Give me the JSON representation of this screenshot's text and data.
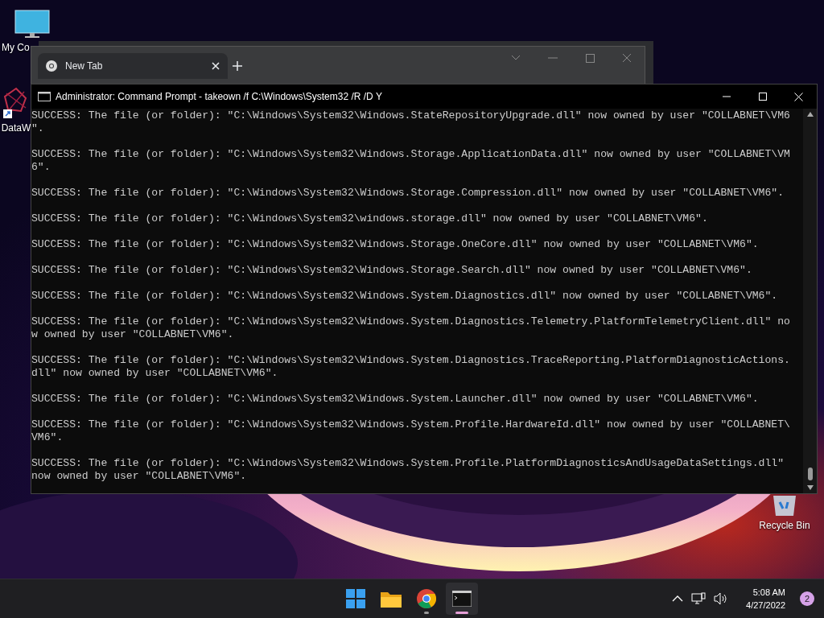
{
  "desktop_icons": [
    {
      "kind": "computer",
      "label": "My Co"
    },
    {
      "kind": "app",
      "label": "DataW"
    },
    {
      "kind": "recycle",
      "label": "Recycle Bin"
    }
  ],
  "browser_window": {
    "tabs": [
      {
        "title": "New Tab",
        "selected": true
      }
    ]
  },
  "console_window": {
    "title": "Administrator: Command Prompt - takeown  /f C:\\Windows\\System32 /R /D Y",
    "records": [
      {
        "lines": [
          "SUCCESS: The file (or folder): \"C:\\Windows\\System32\\Windows.StateRepositoryUpgrade.dll\" now owned by user \"COLLABNET\\VM6",
          "\"."
        ]
      },
      {
        "lines": [
          "SUCCESS: The file (or folder): \"C:\\Windows\\System32\\Windows.Storage.ApplicationData.dll\" now owned by user \"COLLABNET\\VM",
          "6\"."
        ]
      },
      {
        "lines": [
          "SUCCESS: The file (or folder): \"C:\\Windows\\System32\\Windows.Storage.Compression.dll\" now owned by user \"COLLABNET\\VM6\"."
        ]
      },
      {
        "lines": [
          "SUCCESS: The file (or folder): \"C:\\Windows\\System32\\windows.storage.dll\" now owned by user \"COLLABNET\\VM6\"."
        ]
      },
      {
        "lines": [
          "SUCCESS: The file (or folder): \"C:\\Windows\\System32\\Windows.Storage.OneCore.dll\" now owned by user \"COLLABNET\\VM6\"."
        ]
      },
      {
        "lines": [
          "SUCCESS: The file (or folder): \"C:\\Windows\\System32\\Windows.Storage.Search.dll\" now owned by user \"COLLABNET\\VM6\"."
        ]
      },
      {
        "lines": [
          "SUCCESS: The file (or folder): \"C:\\Windows\\System32\\Windows.System.Diagnostics.dll\" now owned by user \"COLLABNET\\VM6\"."
        ]
      },
      {
        "lines": [
          "SUCCESS: The file (or folder): \"C:\\Windows\\System32\\Windows.System.Diagnostics.Telemetry.PlatformTelemetryClient.dll\" no",
          "w owned by user \"COLLABNET\\VM6\"."
        ]
      },
      {
        "lines": [
          "SUCCESS: The file (or folder): \"C:\\Windows\\System32\\Windows.System.Diagnostics.TraceReporting.PlatformDiagnosticActions.",
          "dll\" now owned by user \"COLLABNET\\VM6\"."
        ]
      },
      {
        "lines": [
          "SUCCESS: The file (or folder): \"C:\\Windows\\System32\\Windows.System.Launcher.dll\" now owned by user \"COLLABNET\\VM6\"."
        ]
      },
      {
        "lines": [
          "SUCCESS: The file (or folder): \"C:\\Windows\\System32\\Windows.System.Profile.HardwareId.dll\" now owned by user \"COLLABNET\\",
          "VM6\"."
        ]
      },
      {
        "lines": [
          "SUCCESS: The file (or folder): \"C:\\Windows\\System32\\Windows.System.Profile.PlatformDiagnosticsAndUsageDataSettings.dll\"",
          "now owned by user \"COLLABNET\\VM6\"."
        ]
      }
    ]
  },
  "taskbar": {
    "apps": [
      {
        "kind": "start",
        "running": false,
        "selected": false
      },
      {
        "kind": "explorer",
        "running": false,
        "selected": false
      },
      {
        "kind": "chrome",
        "running": true,
        "selected": false
      },
      {
        "kind": "terminal",
        "running": true,
        "selected": true
      }
    ],
    "time": "5:08 AM",
    "date": "4/27/2022",
    "notification_count": "2"
  }
}
